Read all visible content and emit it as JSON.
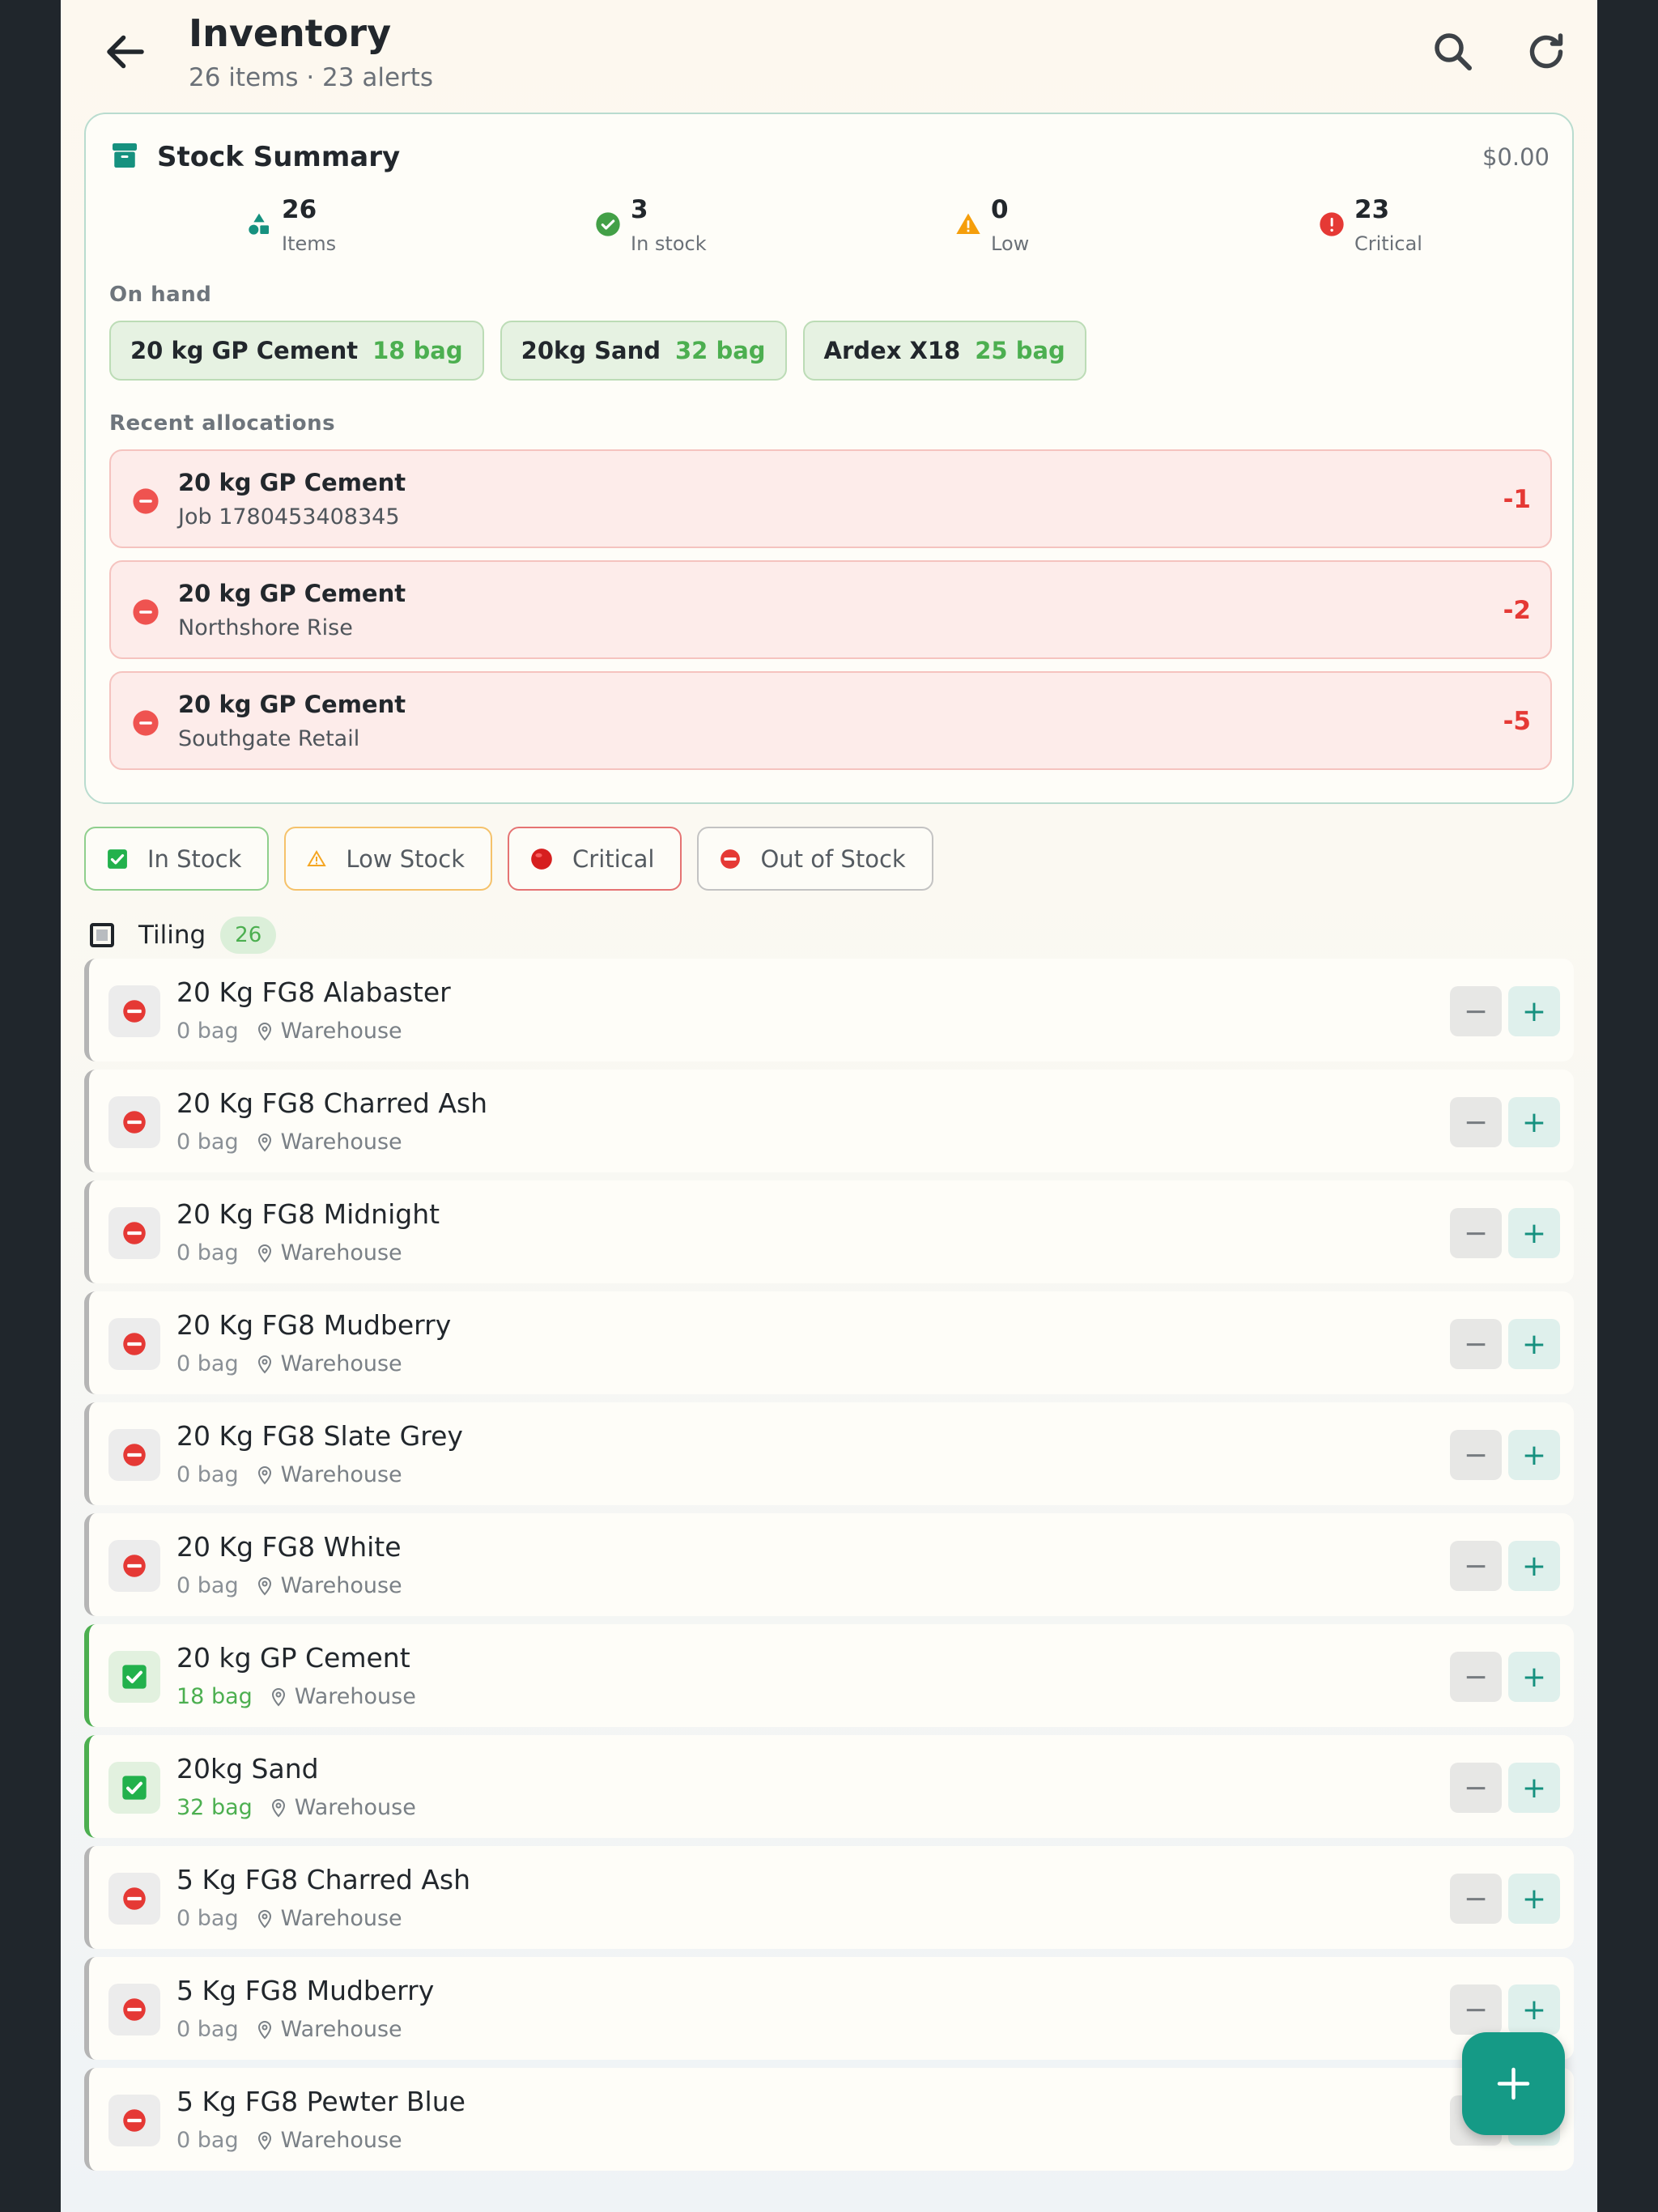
{
  "header": {
    "title": "Inventory",
    "subtitle": "26 items · 23 alerts"
  },
  "summary": {
    "title": "Stock Summary",
    "total_value": "$0.00",
    "stats": [
      {
        "value": "26",
        "label": "Items",
        "icon": "shapes-icon",
        "color": "#16917f"
      },
      {
        "value": "3",
        "label": "In stock",
        "icon": "check-circle-icon",
        "color": "#43a047"
      },
      {
        "value": "0",
        "label": "Low",
        "icon": "warning-icon",
        "color": "#f59e0b"
      },
      {
        "value": "23",
        "label": "Critical",
        "icon": "alert-circle-icon",
        "color": "#e53935"
      }
    ],
    "on_hand_label": "On hand",
    "on_hand": [
      {
        "name": "20 kg GP Cement",
        "qty": "18 bag"
      },
      {
        "name": "20kg Sand",
        "qty": "32 bag"
      },
      {
        "name": "Ardex X18",
        "qty": "25 bag"
      }
    ],
    "recent_label": "Recent allocations",
    "allocations": [
      {
        "name": "20 kg GP Cement",
        "job": "Job 1780453408345",
        "qty": "-1"
      },
      {
        "name": "20 kg GP Cement",
        "job": "Northshore Rise",
        "qty": "-2"
      },
      {
        "name": "20 kg GP Cement",
        "job": "Southgate Retail",
        "qty": "-5"
      }
    ]
  },
  "filters": [
    {
      "label": "In Stock",
      "icon": "checkbox-icon"
    },
    {
      "label": "Low Stock",
      "icon": "warning-icon"
    },
    {
      "label": "Critical",
      "icon": "red-circle-icon"
    },
    {
      "label": "Out of Stock",
      "icon": "no-entry-icon"
    }
  ],
  "group": {
    "name": "Tiling",
    "count": "26"
  },
  "items": [
    {
      "name": "20 Kg FG8 Alabaster",
      "qty": "0 bag",
      "location": "Warehouse",
      "status": "out"
    },
    {
      "name": "20 Kg FG8 Charred Ash",
      "qty": "0 bag",
      "location": "Warehouse",
      "status": "out"
    },
    {
      "name": "20 Kg FG8 Midnight",
      "qty": "0 bag",
      "location": "Warehouse",
      "status": "out"
    },
    {
      "name": "20 Kg FG8 Mudberry",
      "qty": "0 bag",
      "location": "Warehouse",
      "status": "out"
    },
    {
      "name": "20 Kg FG8 Slate Grey",
      "qty": "0 bag",
      "location": "Warehouse",
      "status": "out"
    },
    {
      "name": "20 Kg FG8 White",
      "qty": "0 bag",
      "location": "Warehouse",
      "status": "out"
    },
    {
      "name": "20 kg GP Cement",
      "qty": "18 bag",
      "location": "Warehouse",
      "status": "ok"
    },
    {
      "name": "20kg Sand",
      "qty": "32 bag",
      "location": "Warehouse",
      "status": "ok"
    },
    {
      "name": "5 Kg FG8 Charred Ash",
      "qty": "0 bag",
      "location": "Warehouse",
      "status": "out"
    },
    {
      "name": "5 Kg FG8 Mudberry",
      "qty": "0 bag",
      "location": "Warehouse",
      "status": "out"
    },
    {
      "name": "5 Kg FG8 Pewter Blue",
      "qty": "0 bag",
      "location": "Warehouse",
      "status": "out"
    }
  ],
  "colors": {
    "accent": "#159a86",
    "in_stock": "#4caf50",
    "critical": "#e53935",
    "low": "#f59e0b"
  }
}
